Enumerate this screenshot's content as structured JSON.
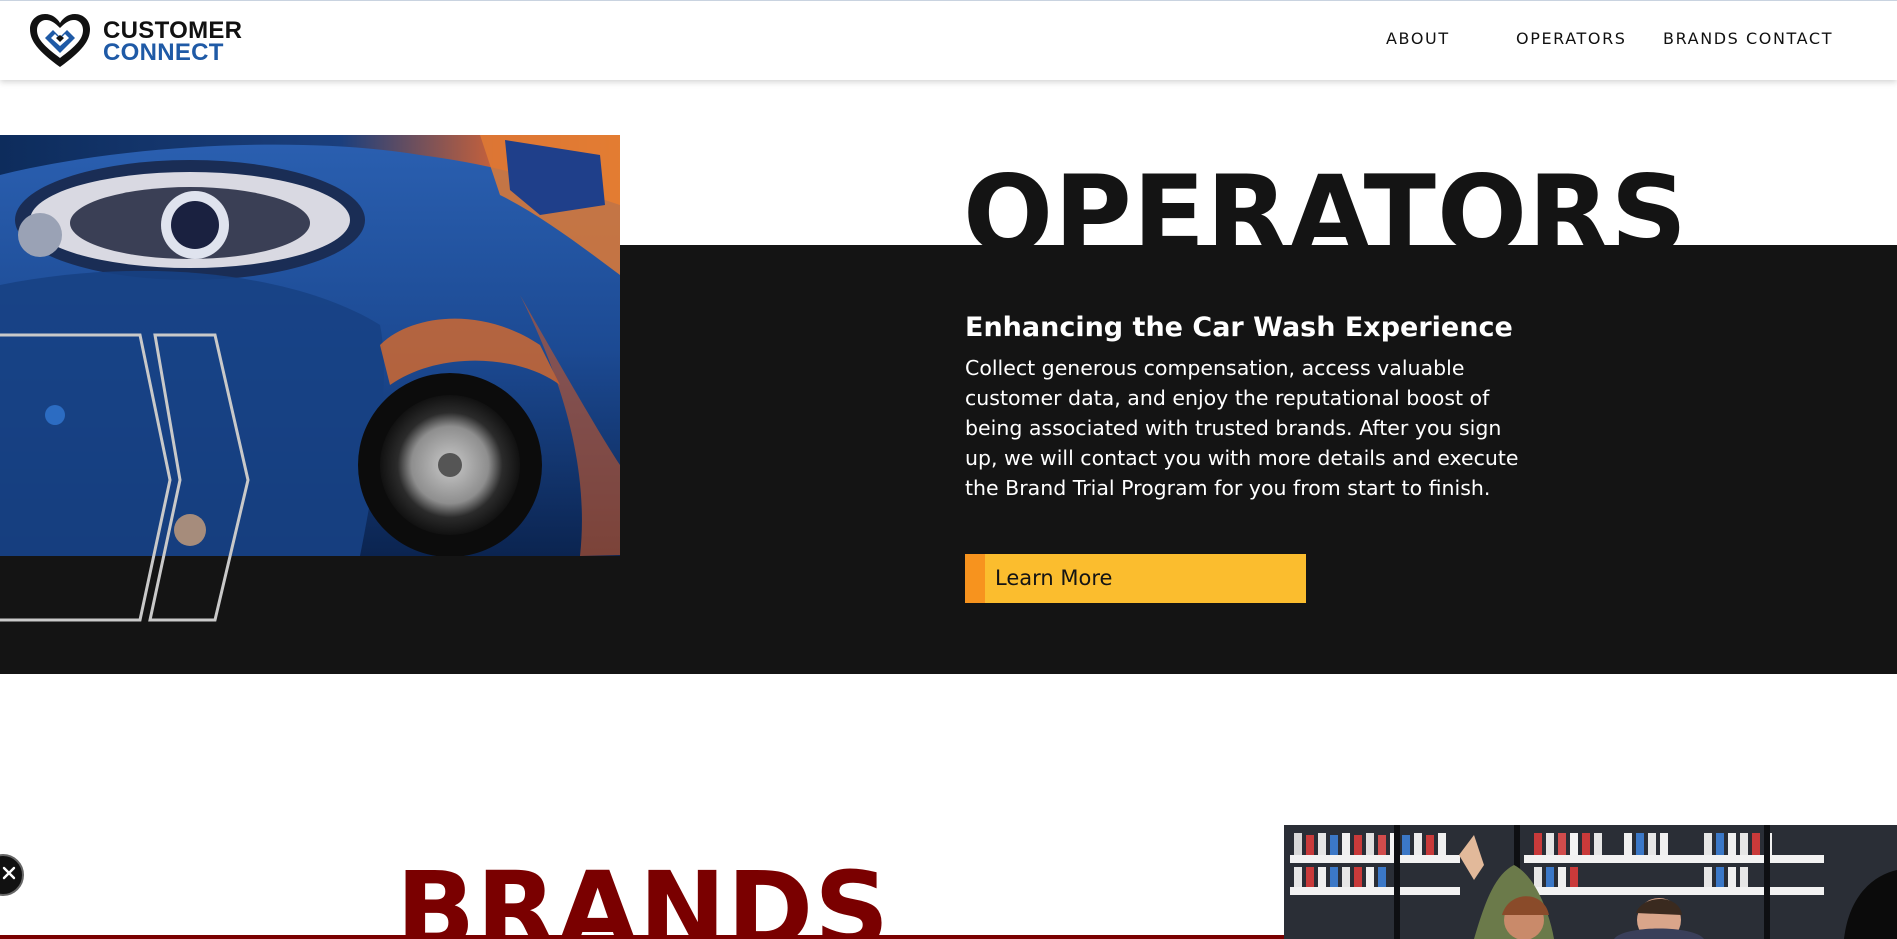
{
  "header": {
    "logo": {
      "line1": "CUSTOMER",
      "line2": "CONNECT"
    },
    "nav": [
      {
        "label": "ABOUT"
      },
      {
        "label": "OPERATORS"
      },
      {
        "label": "BRANDS"
      },
      {
        "label": "CONTACT"
      }
    ]
  },
  "operators": {
    "title": "OPERATORS",
    "subtitle": "Enhancing the Car Wash Experience",
    "body": "Collect generous compensation, access valuable customer data, and enjoy the reputational boost of being associated with trusted brands. After you sign up, we will contact you with more details and execute the Brand Trial Program for you from start to finish.",
    "button_label": "Learn More"
  },
  "brands": {
    "title": "BRANDS"
  },
  "colors": {
    "dark": "#141414",
    "brand_blue": "#1f5aa6",
    "button_yellow": "#fbbd2e",
    "button_accent": "#f7931e",
    "brands_red": "#7a0000"
  },
  "icons": {
    "logo": "heart-logo-icon",
    "close": "close-icon"
  }
}
